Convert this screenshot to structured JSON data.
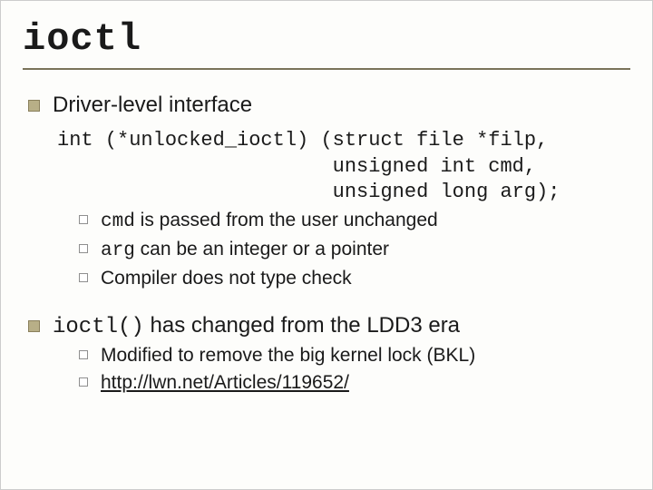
{
  "title": "ioctl",
  "point1": {
    "heading": "Driver-level interface",
    "code": "int (*unlocked_ioctl) (struct file *filp,\n                       unsigned int cmd,\n                       unsigned long arg);",
    "sub": [
      {
        "mono": "cmd",
        "rest": " is passed from the user unchanged"
      },
      {
        "mono": "arg",
        "rest": " can be an integer or a pointer"
      },
      {
        "mono": "",
        "rest": "Compiler does not type check"
      }
    ]
  },
  "point2": {
    "mono": "ioctl()",
    "rest": " has changed from the LDD3 era",
    "sub": [
      {
        "text": "Modified to remove the big kernel lock (BKL)"
      },
      {
        "link": "http://lwn.net/Articles/119652/"
      }
    ]
  }
}
